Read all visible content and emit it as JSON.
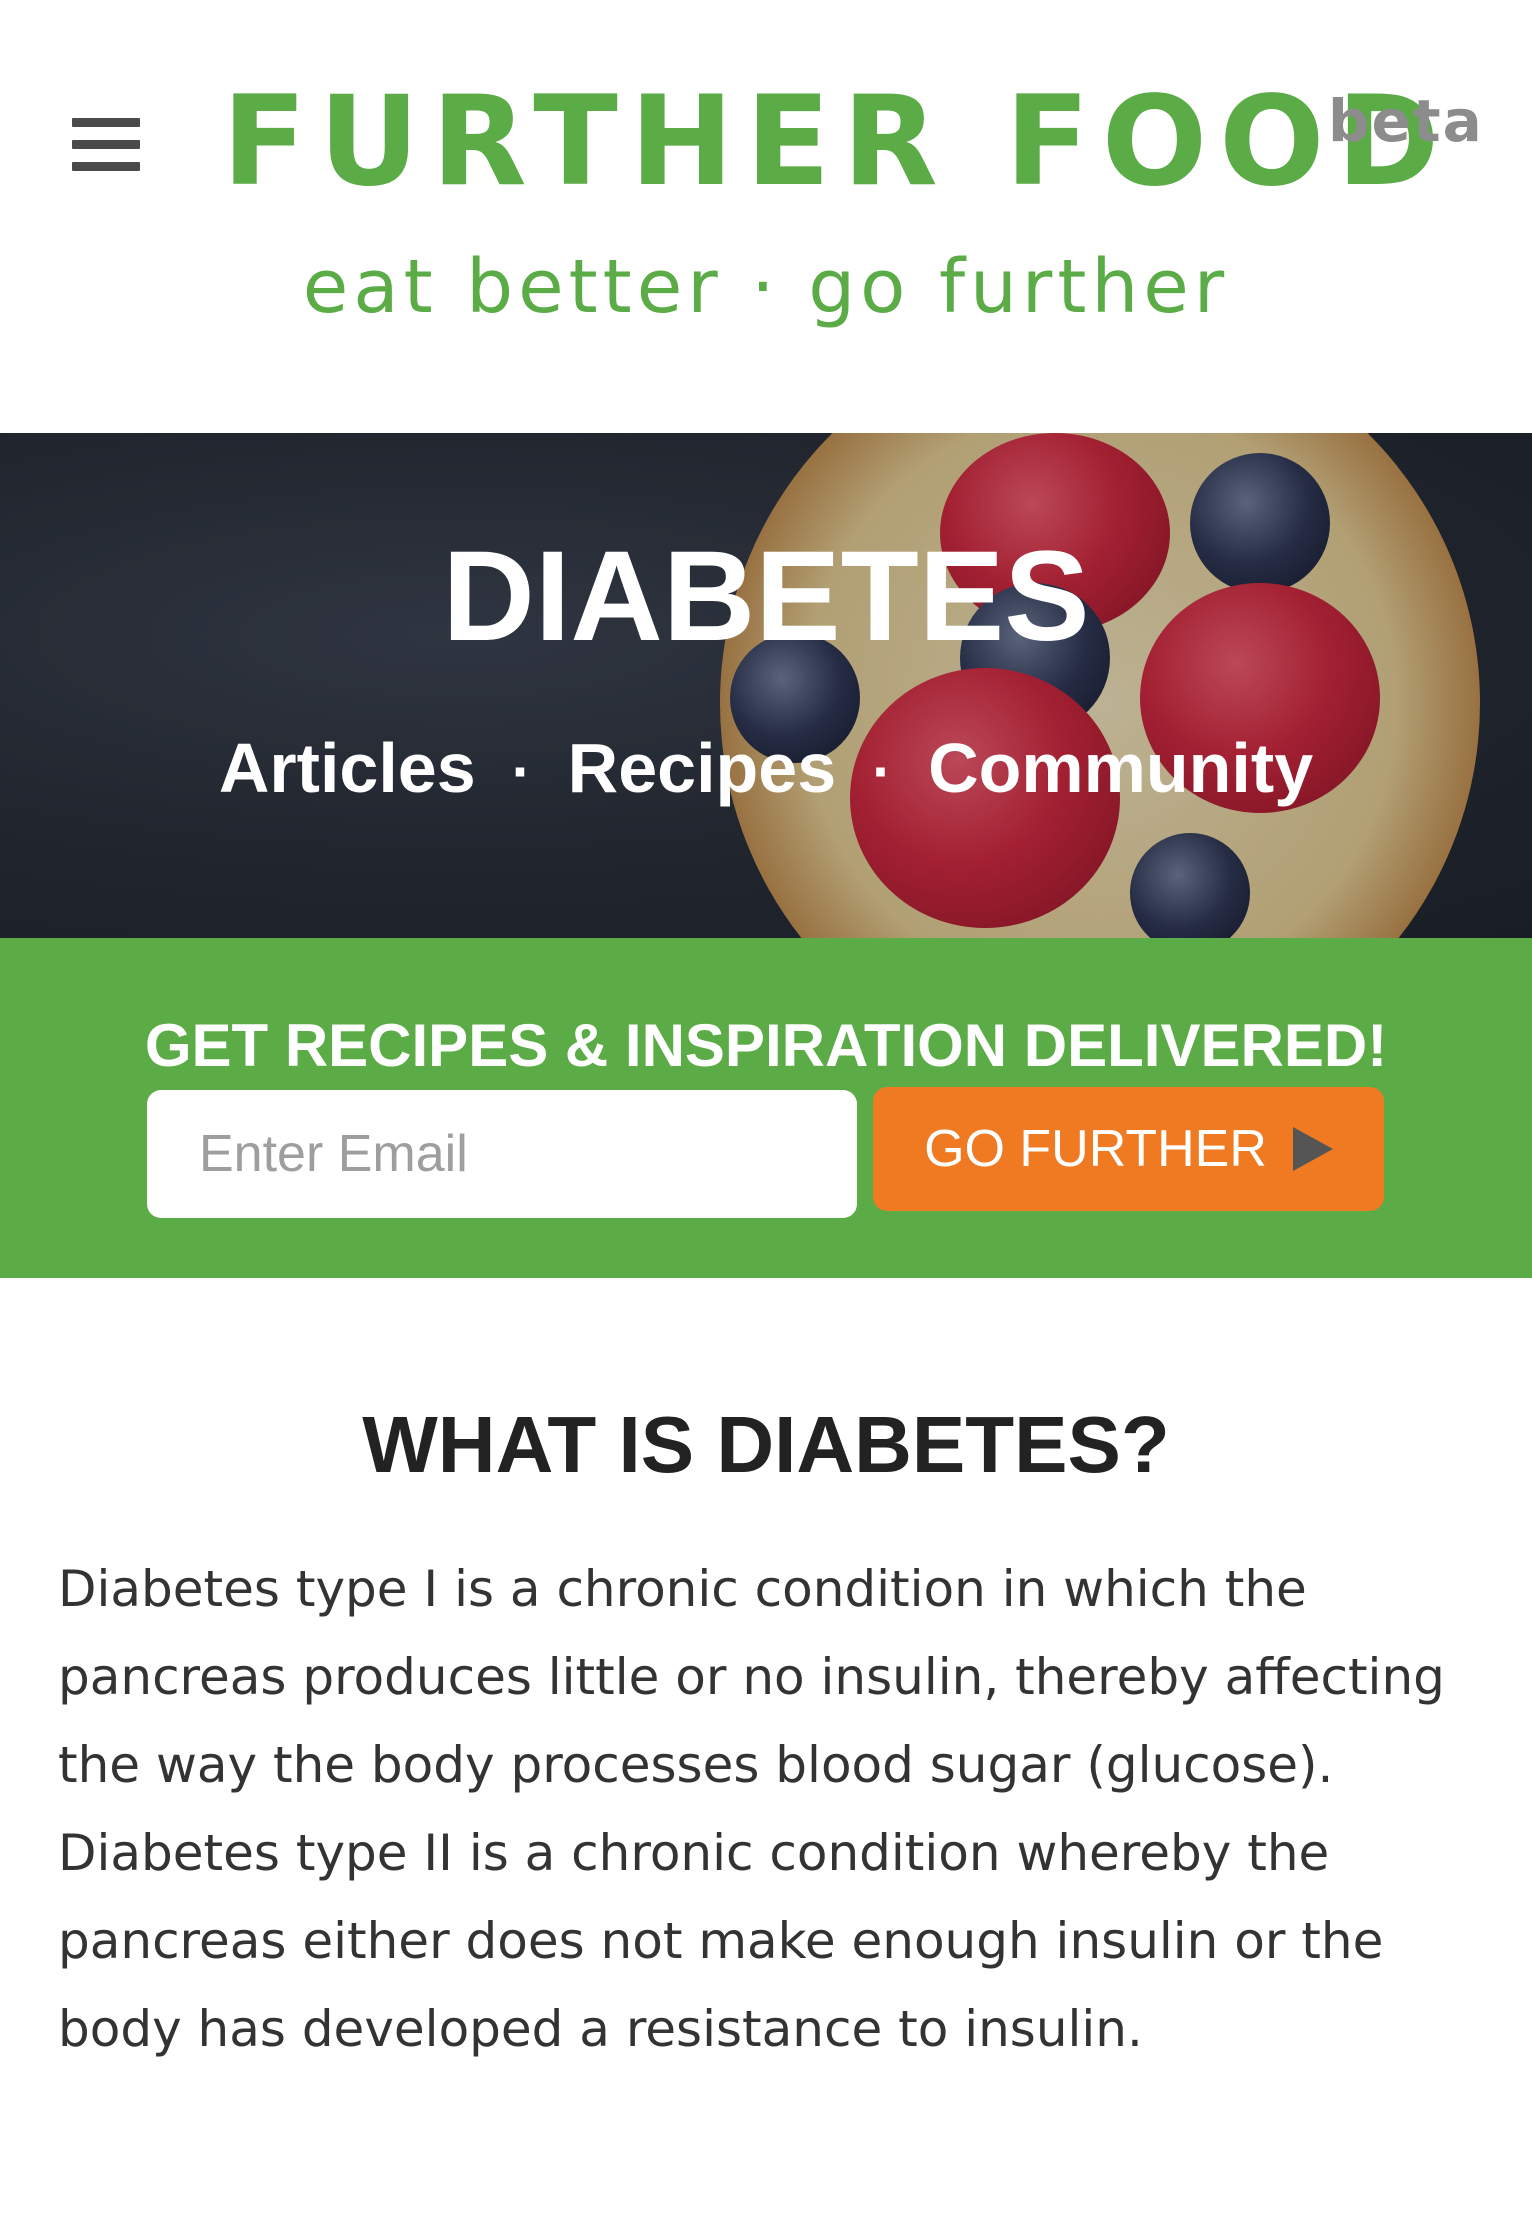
{
  "header": {
    "menu_icon": "hamburger-menu-icon",
    "brand": "FURTHER FOOD",
    "badge": "beta",
    "tagline": "eat better · go further",
    "brand_color": "#5bab47"
  },
  "hero": {
    "title": "DIABETES",
    "nav": [
      {
        "label": "Articles"
      },
      {
        "label": "Recipes"
      },
      {
        "label": "Community"
      }
    ],
    "separator": "·"
  },
  "signup": {
    "title": "GET RECIPES & INSPIRATION DELIVERED!",
    "email_placeholder": "Enter Email",
    "email_value": "",
    "button_label": "GO FURTHER",
    "button_icon": "play-arrow-icon",
    "band_color": "#5bab47",
    "button_color": "#f07a22"
  },
  "content": {
    "heading": "WHAT IS DIABETES?",
    "body": "Diabetes type I is a chronic condition in which the pancreas produces little or no insulin, thereby affecting the way the body processes blood sugar (glucose). Diabetes type II is a chronic condition whereby the pancreas either does not make enough insulin or the body has developed a resistance to insulin."
  }
}
